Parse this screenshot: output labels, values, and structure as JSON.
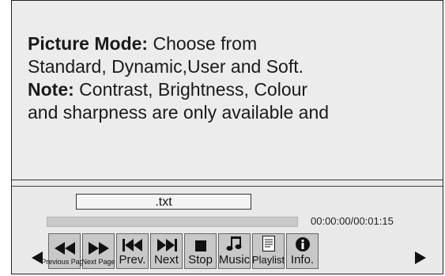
{
  "description": {
    "picture_mode_label": "Picture Mode:",
    "picture_mode_text": " Choose from",
    "line2": "Standard, Dynamic,User and Soft.",
    "note_label": "Note:",
    "note_text": " Contrast, Brightness, Colour",
    "line4": "and sharpness are only available and"
  },
  "player": {
    "filename": ".txt",
    "time": "00:00:00/00:01:15",
    "progress_fraction": 0
  },
  "buttons": [
    {
      "label": "Previous Page",
      "icon": "rewind-icon"
    },
    {
      "label": "Next Page",
      "icon": "fast-forward-icon"
    },
    {
      "label": "Prev.",
      "icon": "skip-previous-icon"
    },
    {
      "label": "Next",
      "icon": "skip-next-icon"
    },
    {
      "label": "Stop",
      "icon": "stop-icon"
    },
    {
      "label": "Music",
      "icon": "music-note-icon"
    },
    {
      "label": "Playlist",
      "icon": "playlist-icon"
    },
    {
      "label": "Info.",
      "icon": "info-icon"
    }
  ],
  "nav": {
    "left_icon": "arrow-left-icon",
    "right_icon": "arrow-right-icon"
  }
}
